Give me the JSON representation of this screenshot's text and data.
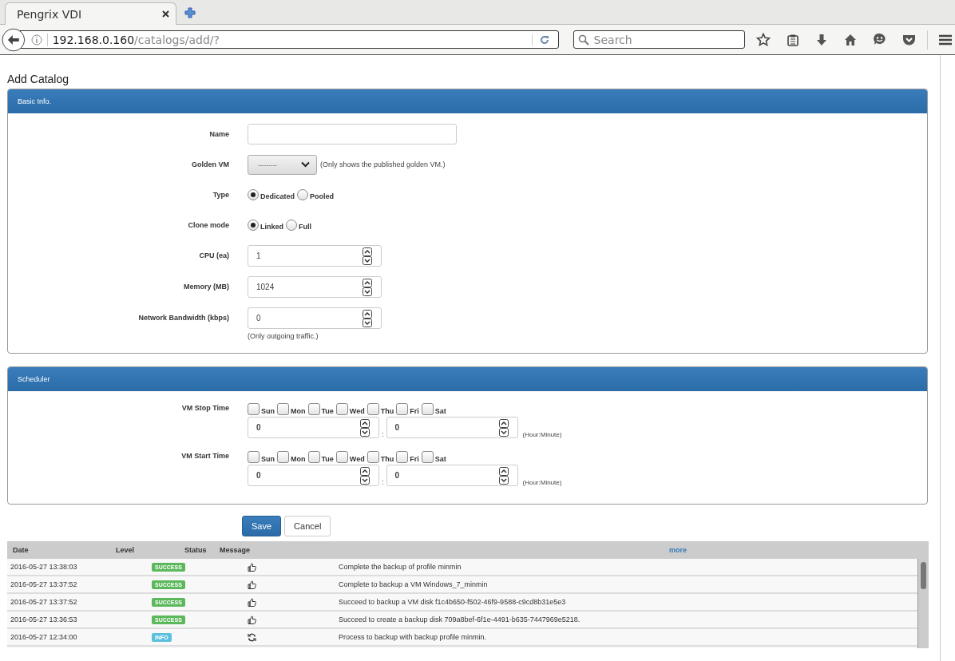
{
  "browser": {
    "tab_title": "Pengrix VDI",
    "address_host": "192.168.0.160",
    "address_path": "/catalogs/add/?",
    "search_placeholder": "Search"
  },
  "page_title": "Add Catalog",
  "basic_info": {
    "title": "Basic Info.",
    "fields": [
      {
        "kind": "text",
        "label": "Name"
      },
      {
        "kind": "select",
        "label": "Golden VM",
        "value": "---------",
        "note": "(Only shows the published golden VM.)"
      },
      {
        "kind": "radio",
        "label": "Type",
        "options": [
          {
            "label": "Dedicated",
            "selected": true
          },
          {
            "label": "Pooled",
            "selected": false
          }
        ]
      },
      {
        "kind": "radio",
        "label": "Clone mode",
        "options": [
          {
            "label": "Linked",
            "selected": true
          },
          {
            "label": "Full",
            "selected": false
          }
        ]
      },
      {
        "kind": "number",
        "label": "CPU (ea)",
        "value": "1"
      },
      {
        "kind": "number",
        "label": "Memory (MB)",
        "value": "1024"
      },
      {
        "kind": "number",
        "label": "Network Bandwidth (kbps)",
        "value": "0",
        "note": "(Only outgoing traffic.)"
      }
    ]
  },
  "scheduler": {
    "title": "Scheduler",
    "rows": [
      {
        "label": "VM Stop Time",
        "days": [
          {
            "label": "Sun",
            "checked": false
          },
          {
            "label": "Mon",
            "checked": false
          },
          {
            "label": "Tue",
            "checked": false
          },
          {
            "label": "Wed",
            "checked": false
          },
          {
            "label": "Thu",
            "checked": false
          },
          {
            "label": "Fri",
            "checked": false
          },
          {
            "label": "Sat",
            "checked": false
          }
        ],
        "hour": "0",
        "separator": ":",
        "minute": "0",
        "note": "(Hour:Minute)"
      },
      {
        "label": "VM Start Time",
        "days": [
          {
            "label": "Sun",
            "checked": false
          },
          {
            "label": "Mon",
            "checked": false
          },
          {
            "label": "Tue",
            "checked": false
          },
          {
            "label": "Wed",
            "checked": false
          },
          {
            "label": "Thu",
            "checked": false
          },
          {
            "label": "Fri",
            "checked": false
          },
          {
            "label": "Sat",
            "checked": false
          }
        ],
        "hour": "0",
        "separator": ":",
        "minute": "0",
        "note": "(Hour:Minute)"
      }
    ]
  },
  "buttons": [
    {
      "label": "Save",
      "kind": "primary"
    },
    {
      "label": "Cancel",
      "kind": "default"
    }
  ],
  "log": {
    "columns": [
      "Date",
      "Level",
      "Status",
      "Message"
    ],
    "more": "more",
    "rows": [
      {
        "date": "2016-05-27 13:38:03",
        "level": "SUCCESS",
        "kind": "success",
        "message": "Complete the backup of profile minmin"
      },
      {
        "date": "2016-05-27 13:37:52",
        "level": "SUCCESS",
        "kind": "success",
        "message": "Complete to backup a VM Windows_7_minmin"
      },
      {
        "date": "2016-05-27 13:37:52",
        "level": "SUCCESS",
        "kind": "success",
        "message": "Succeed to backup a VM disk f1c4b650-f502-46f9-9588-c9cd8b31e5e3"
      },
      {
        "date": "2016-05-27 13:36:53",
        "level": "SUCCESS",
        "kind": "success",
        "message": "Succeed to create a backup disk 709a8bef-6f1e-4491-b635-7447969e5218."
      },
      {
        "date": "2016-05-27 12:34:00",
        "level": "INFO",
        "kind": "info",
        "message": "Process to backup with backup profile minmin."
      }
    ]
  }
}
